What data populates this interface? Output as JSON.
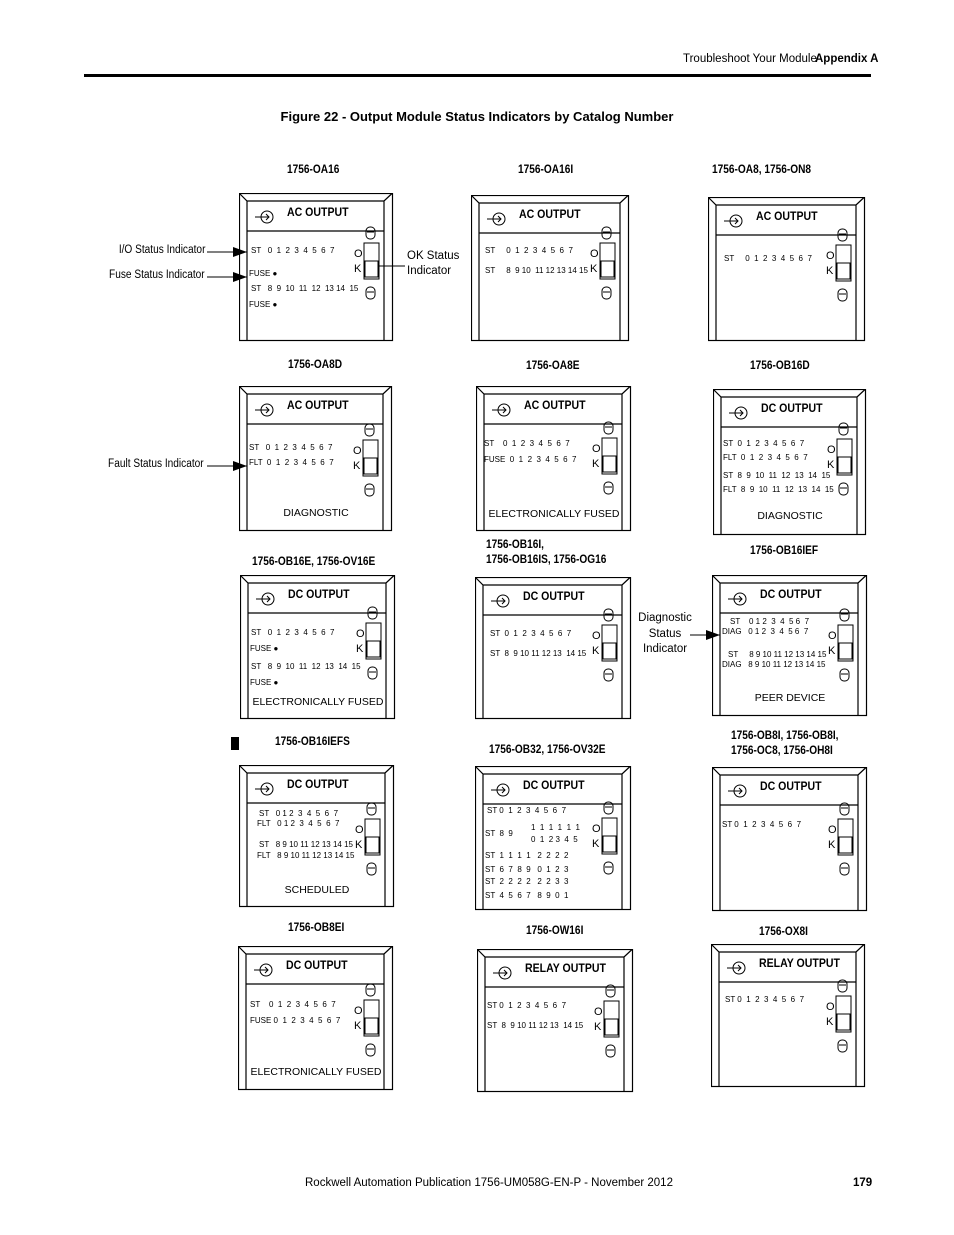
{
  "header": {
    "section": "Troubleshoot Your Module",
    "appendix": "Appendix A"
  },
  "figure_title": "Figure 22 - Output Module Status Indicators by Catalog Number",
  "callouts": {
    "io_status": "I/O Status Indicator",
    "fuse_status": "Fuse Status Indicator",
    "ok_status": [
      "OK Status",
      "Indicator"
    ],
    "fault_status": "Fault Status Indicator",
    "diag_status": [
      "Diagnostic",
      "Status",
      "Indicator"
    ]
  },
  "modules": [
    {
      "catalog": [
        "1756-OA16"
      ],
      "title": "AC OUTPUT",
      "lines": [
        "ST   0  1  2  3  4  5  6  7",
        "FUSE ●",
        "ST   8  9  10  11  12  13 14  15",
        "FUSE ●"
      ],
      "footer": ""
    },
    {
      "catalog": [
        "1756-OA16I"
      ],
      "title": "AC OUTPUT",
      "lines": [
        "ST     0  1  2  3  4  5  6  7",
        "ST     8  9 10  11 12 13 14 15"
      ],
      "footer": ""
    },
    {
      "catalog": [
        "1756-OA8, 1756-ON8"
      ],
      "title": "AC OUTPUT",
      "lines": [
        "ST     0  1  2  3  4  5  6  7"
      ],
      "footer": ""
    },
    {
      "catalog": [
        "1756-OA8D"
      ],
      "title": "AC OUTPUT",
      "lines": [
        "ST   0  1  2  3  4  5  6  7",
        "FLT  0  1  2  3  4  5  6  7"
      ],
      "footer": "DIAGNOSTIC"
    },
    {
      "catalog": [
        "1756-OA8E"
      ],
      "title": "AC OUTPUT",
      "lines": [
        "ST    0  1  2  3  4  5  6  7",
        "FUSE  0  1  2  3  4  5  6  7"
      ],
      "footer": "ELECTRONICALLY FUSED"
    },
    {
      "catalog": [
        "1756-OB16D"
      ],
      "title": "DC OUTPUT",
      "lines": [
        "ST  0  1  2  3  4  5  6  7",
        "FLT  0  1  2  3  4  5  6  7",
        "ST  8  9  10  11  12  13  14  15",
        "FLT  8  9  10  11  12  13  14  15"
      ],
      "footer": "DIAGNOSTIC"
    },
    {
      "catalog": [
        "1756-OB16E, 1756-OV16E"
      ],
      "title": "DC OUTPUT",
      "lines": [
        "ST   0  1  2  3  4  5  6  7",
        "FUSE ●",
        "ST   8  9  10  11  12  13  14  15",
        "FUSE ●"
      ],
      "footer": "ELECTRONICALLY FUSED"
    },
    {
      "catalog": [
        "1756-OB16I,",
        "1756-OB16IS, 1756-OG16"
      ],
      "title": "DC OUTPUT",
      "lines": [
        "ST  0  1  2  3  4  5  6  7",
        "ST  8  9 10 11 12 13  14 15"
      ],
      "footer": ""
    },
    {
      "catalog": [
        "1756-OB16IEF"
      ],
      "title": "DC OUTPUT",
      "lines": [
        "ST    0 1 2  3  4  5 6  7",
        "DIAG   0 1 2  3  4  5 6  7",
        "ST     8 9 10 11 12 13 14 15",
        "DIAG   8 9 10 11 12 13 14 15"
      ],
      "footer": "PEER DEVICE"
    },
    {
      "catalog": [
        "1756-OB16IEFS"
      ],
      "title": "DC OUTPUT",
      "lines": [
        "ST   0 1 2  3  4  5  6  7",
        "FLT   0 1 2  3  4  5  6  7",
        "ST   8 9 10 11 12 13 14 15",
        "FLT   8 9 10 11 12 13 14 15"
      ],
      "footer": "SCHEDULED"
    },
    {
      "catalog": [
        "1756-OB32,  1756-OV32E"
      ],
      "title": "DC OUTPUT",
      "lines": [
        "ST 0  1  2  3  4  5  6  7",
        "1  1  1  1  1  1",
        "ST  8  9",
        "0  1  2 3  4  5",
        "ST  1  1  1  1   2  2  2  2",
        "ST  6  7  8  9   0  1  2  3",
        "ST  2  2  2  2   2  2  3  3",
        "ST  4  5  6  7   8  9  0  1"
      ],
      "footer": ""
    },
    {
      "catalog": [
        "1756-OB8I, 1756-OB8I,",
        "1756-OC8, 1756-OH8I"
      ],
      "title": "DC OUTPUT",
      "lines": [
        "ST 0  1  2  3  4  5  6  7"
      ],
      "footer": ""
    },
    {
      "catalog": [
        "1756-OB8EI"
      ],
      "title": "DC OUTPUT",
      "lines": [
        "ST    0  1  2  3  4  5  6  7",
        "FUSE 0  1  2  3  4  5  6  7"
      ],
      "footer": "ELECTRONICALLY FUSED"
    },
    {
      "catalog": [
        "1756-OW16I"
      ],
      "title": "RELAY OUTPUT",
      "lines": [
        "ST 0  1  2  3  4  5  6  7",
        "ST  8  9 10 11 12 13  14 15"
      ],
      "footer": ""
    },
    {
      "catalog": [
        "1756-OX8I"
      ],
      "title": "RELAY OUTPUT",
      "lines": [
        "ST 0  1  2  3  4  5  6  7"
      ],
      "footer": ""
    }
  ],
  "ok_letters": [
    "O",
    "K"
  ],
  "footer": {
    "publication": "Rockwell Automation Publication 1756-UM058G-EN-P - November 2012",
    "page_number": "179"
  }
}
